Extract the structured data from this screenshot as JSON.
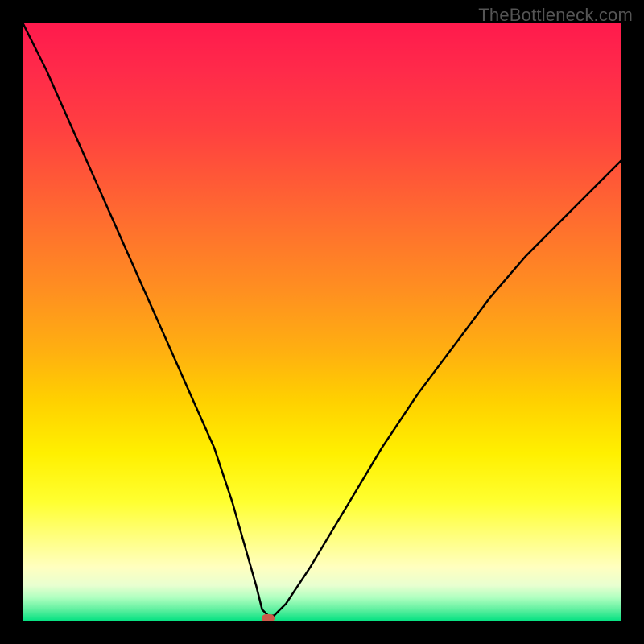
{
  "watermark": "TheBottleneck.com",
  "chart_data": {
    "type": "line",
    "title": "",
    "xlabel": "",
    "ylabel": "",
    "xlim": [
      0,
      100
    ],
    "ylim": [
      0,
      100
    ],
    "axes_visible": false,
    "grid": false,
    "background_gradient": {
      "top": "#ff1a4d",
      "mid": "#ffe000",
      "bottom": "#00e080"
    },
    "series": [
      {
        "name": "bottleneck-curve",
        "color": "#000000",
        "x": [
          0,
          4,
          8,
          12,
          16,
          20,
          24,
          28,
          32,
          35,
          37,
          39,
          40,
          41,
          42,
          44,
          48,
          54,
          60,
          66,
          72,
          78,
          84,
          90,
          96,
          100
        ],
        "y": [
          100,
          92,
          83,
          74,
          65,
          56,
          47,
          38,
          29,
          20,
          13,
          6,
          2,
          1,
          1,
          3,
          9,
          19,
          29,
          38,
          46,
          54,
          61,
          67,
          73,
          77
        ]
      }
    ],
    "minimum_marker": {
      "x": 41,
      "y": 0.5,
      "color": "#cc5a4a"
    }
  }
}
